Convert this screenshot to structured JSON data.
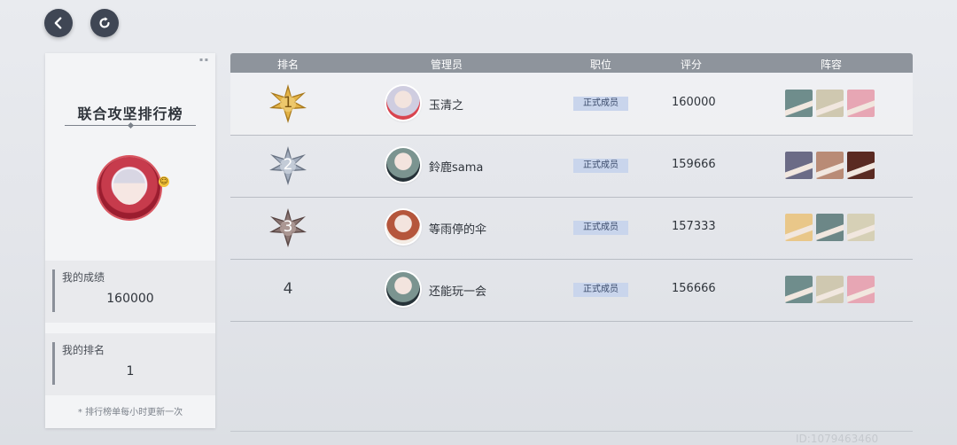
{
  "nav": {
    "back_icon": "chevron-left-icon",
    "refresh_icon": "refresh-icon"
  },
  "left_panel": {
    "title": "联合攻坚排行榜",
    "my_score_label": "我的成绩",
    "my_score_value": "160000",
    "my_rank_label": "我的排名",
    "my_rank_value": "1",
    "footnote": "* 排行榜单每小时更新一次"
  },
  "table": {
    "headers": {
      "rank": "排名",
      "manager": "管理员",
      "role": "职位",
      "score": "评分",
      "team": "阵容"
    },
    "rows": [
      {
        "rank": "1",
        "badge": "gold",
        "name": "玉清之",
        "role": "正式成员",
        "score": "160000",
        "avatar_colors": [
          "#cfcde0",
          "#d9444f"
        ],
        "team": [
          "#6f8d8c",
          "#cfc8b0",
          "#e7a6b4"
        ]
      },
      {
        "rank": "2",
        "badge": "silver",
        "name": "鈴鹿sama",
        "role": "正式成员",
        "score": "159666",
        "avatar_colors": [
          "#7b9490",
          "#263238"
        ],
        "team": [
          "#6b6b86",
          "#b98b76",
          "#5a2a22"
        ]
      },
      {
        "rank": "3",
        "badge": "bronze",
        "name": "等雨停的伞",
        "role": "正式成员",
        "score": "157333",
        "avatar_colors": [
          "#b5563c",
          "#f4ece4"
        ],
        "team": [
          "#e9c789",
          "#6c8787",
          "#d6d0b6"
        ]
      },
      {
        "rank": "4",
        "badge": "none",
        "name": "还能玩一会",
        "role": "正式成员",
        "score": "156666",
        "avatar_colors": [
          "#7b9490",
          "#263238"
        ],
        "team": [
          "#6f8d8c",
          "#cfc8b0",
          "#e7a6b4"
        ]
      }
    ]
  },
  "footer": {
    "id_text": "ID:1079463460"
  }
}
